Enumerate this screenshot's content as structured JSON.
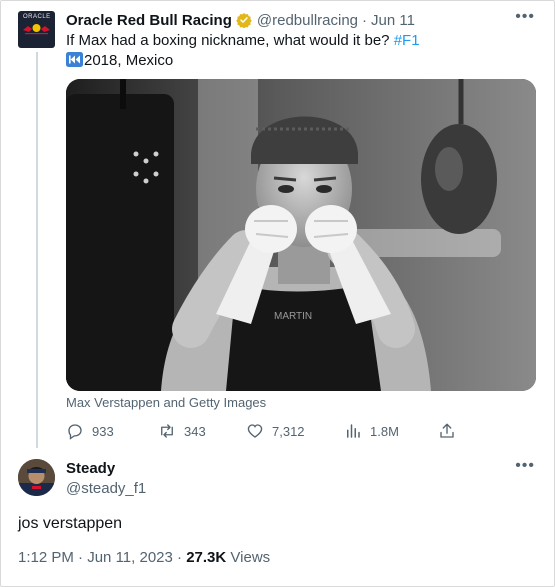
{
  "post": {
    "org_logo_text": "ORACLE",
    "display_name": "Oracle Red Bull Racing",
    "handle": "@redbullracing",
    "separator": "·",
    "date": "Jun 11",
    "text_main": "If Max had a boxing nickname, what would it be? ",
    "hashtag": "#F1",
    "text_line2": "2018, Mexico",
    "photo_caption": "Max Verstappen and Getty Images",
    "photo_shirt_text": "MARTIN",
    "actions": {
      "replies": "933",
      "reposts": "343",
      "likes": "7,312",
      "views": "1.8M"
    }
  },
  "reply": {
    "display_name": "Steady",
    "handle": "@steady_f1",
    "text": "jos verstappen",
    "time": "1:12 PM",
    "date": "Jun 11, 2023",
    "views_count": "27.3K",
    "views_label": "Views"
  },
  "colors": {
    "link": "#1d9bf0",
    "secondary_text": "#536471",
    "verified_badge": "#e2b719"
  }
}
